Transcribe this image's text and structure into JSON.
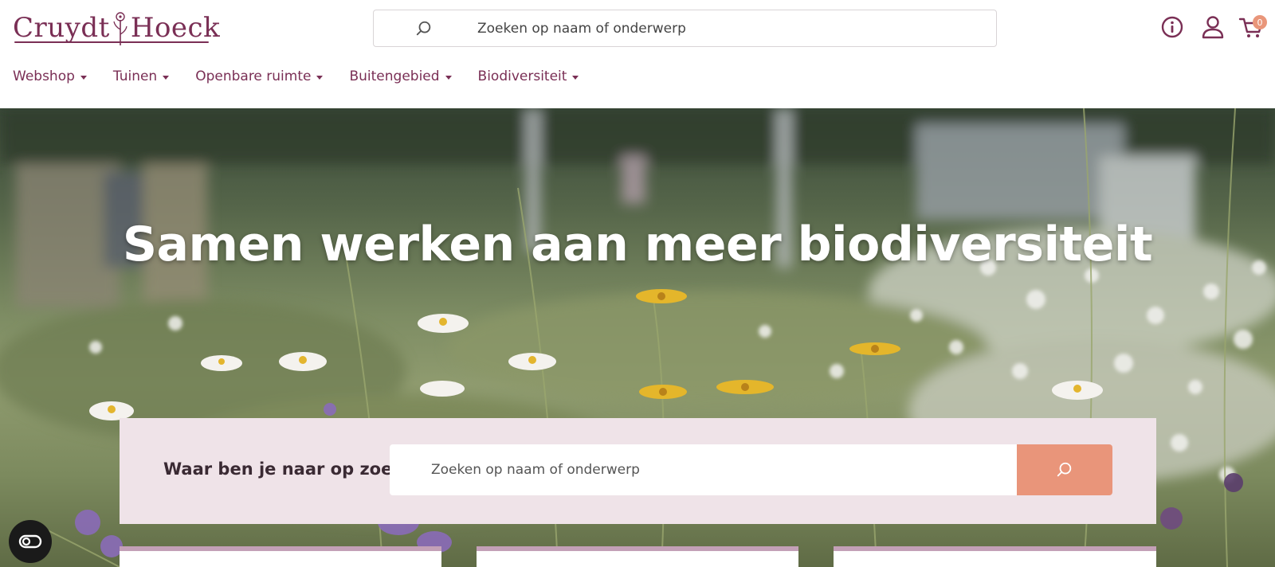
{
  "brand": {
    "logo_text_left": "Cruydt",
    "logo_text_right": "Hoeck",
    "accent": "#7a2f55",
    "cta_color": "#e9957a"
  },
  "header": {
    "search_placeholder": "Zoeken op naam of onderwerp",
    "icons": [
      "info-icon",
      "user-icon",
      "cart-icon"
    ],
    "cart_count": "0"
  },
  "nav": {
    "items": [
      {
        "label": "Webshop"
      },
      {
        "label": "Tuinen"
      },
      {
        "label": "Openbare ruimte"
      },
      {
        "label": "Buitengebied"
      },
      {
        "label": "Biodiversiteit"
      }
    ]
  },
  "hero": {
    "title": "Samen werken aan meer biodiversiteit",
    "search_label": "Waar ben je naar op zoek?",
    "search_placeholder": "Zoeken op naam of onderwerp"
  },
  "accessibility": {
    "icon": "accessibility-toggle-icon"
  }
}
